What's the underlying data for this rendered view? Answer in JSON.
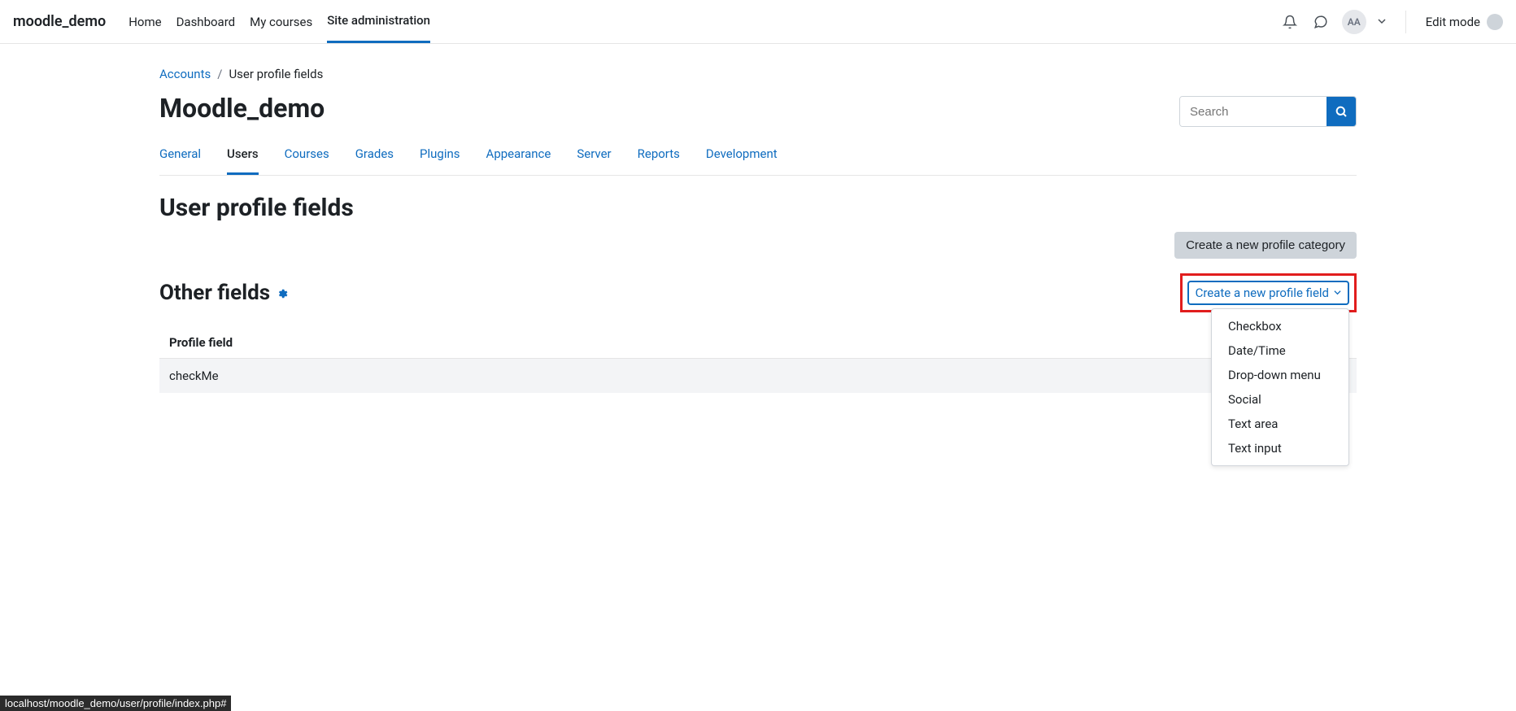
{
  "brand": "moodle_demo",
  "topnav": {
    "home": "Home",
    "dashboard": "Dashboard",
    "mycourses": "My courses",
    "siteadmin": "Site administration"
  },
  "user": {
    "initials": "AA"
  },
  "editmode_label": "Edit mode",
  "breadcrumb": {
    "accounts": "Accounts",
    "current": "User profile fields"
  },
  "sitename": "Moodle_demo",
  "search": {
    "placeholder": "Search"
  },
  "admintabs": {
    "general": "General",
    "users": "Users",
    "courses": "Courses",
    "grades": "Grades",
    "plugins": "Plugins",
    "appearance": "Appearance",
    "server": "Server",
    "reports": "Reports",
    "development": "Development"
  },
  "section_title": "User profile fields",
  "create_category_btn": "Create a new profile category",
  "category_name": "Other fields",
  "create_field_select": "Create a new profile field",
  "field_types": {
    "checkbox": "Checkbox",
    "datetime": "Date/Time",
    "dropdown": "Drop-down menu",
    "social": "Social",
    "textarea": "Text area",
    "textinput": "Text input"
  },
  "table": {
    "header": "Profile field",
    "row0": "checkMe"
  },
  "statusbar": "localhost/moodle_demo/user/profile/index.php#"
}
